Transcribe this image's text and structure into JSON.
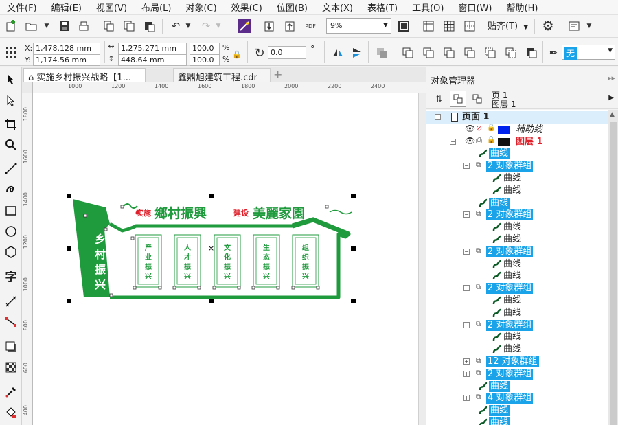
{
  "menu": [
    "文件(F)",
    "编辑(E)",
    "视图(V)",
    "布局(L)",
    "对象(C)",
    "效果(C)",
    "位图(B)",
    "文本(X)",
    "表格(T)",
    "工具(O)",
    "窗口(W)",
    "帮助(H)"
  ],
  "toolbar": {
    "zoom_value": "9%",
    "snap_label": "贴齐(T)",
    "pdf_label": "PDF"
  },
  "props": {
    "x_label": "X:",
    "x_value": "1,478.128 mm",
    "y_label": "Y:",
    "y_value": "1,174.56 mm",
    "w_value": "1,275.271 mm",
    "h_value": "448.64 mm",
    "scale_w": "100.0",
    "scale_h": "100.0",
    "percent": "%",
    "rotation": "0.0",
    "degree": "°",
    "fill": "无"
  },
  "tabs": {
    "doc1": "实施乡村振兴战略【1...",
    "doc2": "鑫鼎旭建筑工程.cdr",
    "add": "+"
  },
  "ruler": {
    "h_labels": [
      "1000",
      "1200",
      "1400",
      "1600",
      "1800",
      "2000",
      "2200",
      "2400"
    ],
    "v_labels": [
      "1800",
      "1600",
      "1400",
      "1200",
      "1000",
      "800",
      "600",
      "400"
    ]
  },
  "design": {
    "title_prefix": "实施",
    "title_main": "鄉村振興",
    "title_prefix2": "建设",
    "title_main2": "美麗家園",
    "side_text": "乡村振兴",
    "panels": [
      "产业振兴",
      "人才振兴",
      "文化振兴",
      "生态振兴",
      "组织振兴"
    ],
    "color_green": "#1f9a3c",
    "color_red": "#e0202a"
  },
  "object_manager": {
    "title": "对象管理器",
    "page_label": "页 1",
    "layer_label": "图层 1",
    "tree": [
      {
        "indent": 0,
        "expander": "−",
        "icon": "page",
        "text": "页面 1",
        "style": "page"
      },
      {
        "indent": 1,
        "expander": "",
        "icon": "guides",
        "text": "辅助线",
        "style": "guides",
        "swatch": "#0022ee"
      },
      {
        "indent": 1,
        "expander": "−",
        "icon": "layer",
        "text": "图层 1",
        "style": "layer",
        "swatch": "#111111"
      },
      {
        "indent": 2,
        "expander": "",
        "icon": "curve",
        "text": "曲线",
        "style": "hl"
      },
      {
        "indent": 2,
        "expander": "−",
        "icon": "group",
        "text": "2 对象群组",
        "style": "hl"
      },
      {
        "indent": 3,
        "expander": "",
        "icon": "curve",
        "text": "曲线",
        "style": "plain"
      },
      {
        "indent": 3,
        "expander": "",
        "icon": "curve",
        "text": "曲线",
        "style": "plain"
      },
      {
        "indent": 2,
        "expander": "",
        "icon": "curve",
        "text": "曲线",
        "style": "hl"
      },
      {
        "indent": 2,
        "expander": "−",
        "icon": "group",
        "text": "2 对象群组",
        "style": "hl"
      },
      {
        "indent": 3,
        "expander": "",
        "icon": "curve",
        "text": "曲线",
        "style": "plain"
      },
      {
        "indent": 3,
        "expander": "",
        "icon": "curve",
        "text": "曲线",
        "style": "plain"
      },
      {
        "indent": 2,
        "expander": "−",
        "icon": "group",
        "text": "2 对象群组",
        "style": "hl"
      },
      {
        "indent": 3,
        "expander": "",
        "icon": "curve",
        "text": "曲线",
        "style": "plain"
      },
      {
        "indent": 3,
        "expander": "",
        "icon": "curve",
        "text": "曲线",
        "style": "plain"
      },
      {
        "indent": 2,
        "expander": "−",
        "icon": "group",
        "text": "2 对象群组",
        "style": "hl"
      },
      {
        "indent": 3,
        "expander": "",
        "icon": "curve",
        "text": "曲线",
        "style": "plain"
      },
      {
        "indent": 3,
        "expander": "",
        "icon": "curve",
        "text": "曲线",
        "style": "plain"
      },
      {
        "indent": 2,
        "expander": "−",
        "icon": "group",
        "text": "2 对象群组",
        "style": "hl"
      },
      {
        "indent": 3,
        "expander": "",
        "icon": "curve",
        "text": "曲线",
        "style": "plain"
      },
      {
        "indent": 3,
        "expander": "",
        "icon": "curve",
        "text": "曲线",
        "style": "plain"
      },
      {
        "indent": 2,
        "expander": "+",
        "icon": "group",
        "text": "12 对象群组",
        "style": "hl"
      },
      {
        "indent": 2,
        "expander": "+",
        "icon": "group",
        "text": "2 对象群组",
        "style": "hl"
      },
      {
        "indent": 2,
        "expander": "",
        "icon": "curve",
        "text": "曲线",
        "style": "hl"
      },
      {
        "indent": 2,
        "expander": "+",
        "icon": "group",
        "text": "4 对象群组",
        "style": "hl"
      },
      {
        "indent": 2,
        "expander": "",
        "icon": "curve",
        "text": "曲线",
        "style": "hl"
      },
      {
        "indent": 2,
        "expander": "",
        "icon": "curve",
        "text": "曲线",
        "style": "hl"
      }
    ]
  }
}
